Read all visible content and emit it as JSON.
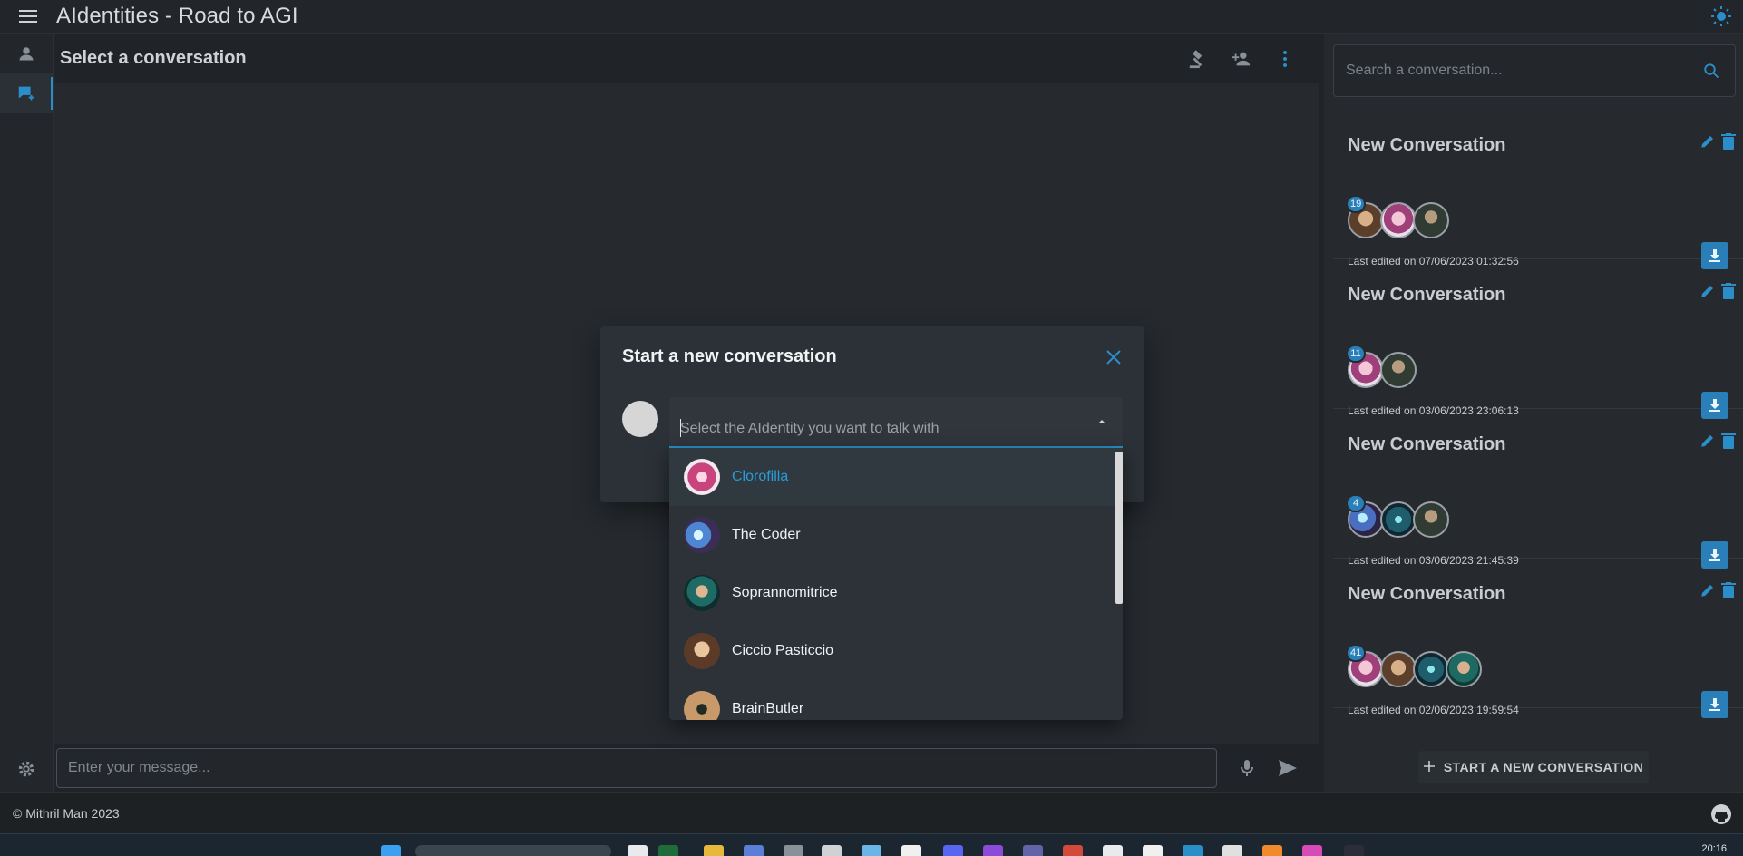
{
  "header": {
    "title": "AIdentities - Road to AGI",
    "icons": {
      "menu": "menu-icon",
      "theme": "sun-icon"
    }
  },
  "rail": {
    "items": [
      {
        "icon": "person-icon"
      },
      {
        "icon": "new-chat-icon",
        "active": true
      }
    ],
    "settings_icon": "gear-icon"
  },
  "chat": {
    "title": "Select a conversation",
    "actions": [
      "gavel-icon",
      "add-person-icon",
      "more-vert-icon"
    ],
    "input_placeholder": "Enter your message...",
    "mic_icon": "mic-icon",
    "send_icon": "send-icon"
  },
  "sidebar": {
    "search_placeholder": "Search a conversation...",
    "conversations": [
      {
        "title": "New Conversation",
        "badge": "19",
        "edited": "Last edited on 07/06/2023 01:32:56",
        "avatars": [
          "old",
          "pink",
          "man"
        ]
      },
      {
        "title": "New Conversation",
        "badge": "11",
        "edited": "Last edited on 03/06/2023 23:06:13",
        "avatars": [
          "pink",
          "man"
        ]
      },
      {
        "title": "New Conversation",
        "badge": "4",
        "edited": "Last edited on 03/06/2023 21:45:39",
        "avatars": [
          "coder",
          "cyber",
          "man"
        ]
      },
      {
        "title": "New Conversation",
        "badge": "41",
        "edited": "Last edited on 02/06/2023 19:59:54",
        "avatars": [
          "pink",
          "old",
          "cyber",
          "teal"
        ]
      }
    ],
    "new_button": "START A NEW CONVERSATION"
  },
  "modal": {
    "title": "Start a new conversation",
    "select_placeholder": "Select the AIdentity you want to talk with",
    "options": [
      {
        "label": "Clorofilla",
        "avatar": "clorofilla",
        "selected": true
      },
      {
        "label": "The Coder",
        "avatar": "coder"
      },
      {
        "label": "Soprannomitrice",
        "avatar": "sopra"
      },
      {
        "label": "Ciccio Pasticcio",
        "avatar": "ciccio"
      },
      {
        "label": "BrainButler",
        "avatar": "brain"
      }
    ]
  },
  "footer": {
    "copyright": "© Mithril Man 2023",
    "github_icon": "github-icon"
  },
  "taskbar": {
    "time": "20:16"
  },
  "colors": {
    "accent": "#2a8ec8",
    "background": "#202327",
    "panel": "#262a2f",
    "modal": "#2b3137"
  }
}
